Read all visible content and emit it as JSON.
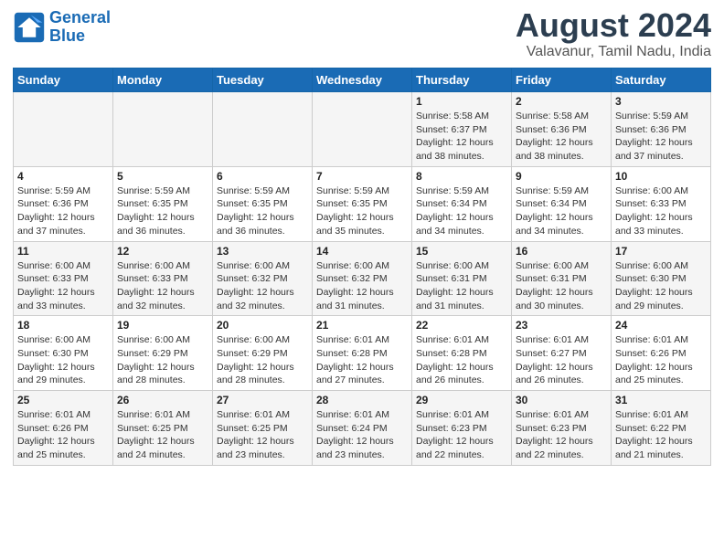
{
  "header": {
    "logo_line1": "General",
    "logo_line2": "Blue",
    "month_year": "August 2024",
    "location": "Valavanur, Tamil Nadu, India"
  },
  "weekdays": [
    "Sunday",
    "Monday",
    "Tuesday",
    "Wednesday",
    "Thursday",
    "Friday",
    "Saturday"
  ],
  "weeks": [
    [
      {
        "day": "",
        "info": ""
      },
      {
        "day": "",
        "info": ""
      },
      {
        "day": "",
        "info": ""
      },
      {
        "day": "",
        "info": ""
      },
      {
        "day": "1",
        "info": "Sunrise: 5:58 AM\nSunset: 6:37 PM\nDaylight: 12 hours\nand 38 minutes."
      },
      {
        "day": "2",
        "info": "Sunrise: 5:58 AM\nSunset: 6:36 PM\nDaylight: 12 hours\nand 38 minutes."
      },
      {
        "day": "3",
        "info": "Sunrise: 5:59 AM\nSunset: 6:36 PM\nDaylight: 12 hours\nand 37 minutes."
      }
    ],
    [
      {
        "day": "4",
        "info": "Sunrise: 5:59 AM\nSunset: 6:36 PM\nDaylight: 12 hours\nand 37 minutes."
      },
      {
        "day": "5",
        "info": "Sunrise: 5:59 AM\nSunset: 6:35 PM\nDaylight: 12 hours\nand 36 minutes."
      },
      {
        "day": "6",
        "info": "Sunrise: 5:59 AM\nSunset: 6:35 PM\nDaylight: 12 hours\nand 36 minutes."
      },
      {
        "day": "7",
        "info": "Sunrise: 5:59 AM\nSunset: 6:35 PM\nDaylight: 12 hours\nand 35 minutes."
      },
      {
        "day": "8",
        "info": "Sunrise: 5:59 AM\nSunset: 6:34 PM\nDaylight: 12 hours\nand 34 minutes."
      },
      {
        "day": "9",
        "info": "Sunrise: 5:59 AM\nSunset: 6:34 PM\nDaylight: 12 hours\nand 34 minutes."
      },
      {
        "day": "10",
        "info": "Sunrise: 6:00 AM\nSunset: 6:33 PM\nDaylight: 12 hours\nand 33 minutes."
      }
    ],
    [
      {
        "day": "11",
        "info": "Sunrise: 6:00 AM\nSunset: 6:33 PM\nDaylight: 12 hours\nand 33 minutes."
      },
      {
        "day": "12",
        "info": "Sunrise: 6:00 AM\nSunset: 6:33 PM\nDaylight: 12 hours\nand 32 minutes."
      },
      {
        "day": "13",
        "info": "Sunrise: 6:00 AM\nSunset: 6:32 PM\nDaylight: 12 hours\nand 32 minutes."
      },
      {
        "day": "14",
        "info": "Sunrise: 6:00 AM\nSunset: 6:32 PM\nDaylight: 12 hours\nand 31 minutes."
      },
      {
        "day": "15",
        "info": "Sunrise: 6:00 AM\nSunset: 6:31 PM\nDaylight: 12 hours\nand 31 minutes."
      },
      {
        "day": "16",
        "info": "Sunrise: 6:00 AM\nSunset: 6:31 PM\nDaylight: 12 hours\nand 30 minutes."
      },
      {
        "day": "17",
        "info": "Sunrise: 6:00 AM\nSunset: 6:30 PM\nDaylight: 12 hours\nand 29 minutes."
      }
    ],
    [
      {
        "day": "18",
        "info": "Sunrise: 6:00 AM\nSunset: 6:30 PM\nDaylight: 12 hours\nand 29 minutes."
      },
      {
        "day": "19",
        "info": "Sunrise: 6:00 AM\nSunset: 6:29 PM\nDaylight: 12 hours\nand 28 minutes."
      },
      {
        "day": "20",
        "info": "Sunrise: 6:00 AM\nSunset: 6:29 PM\nDaylight: 12 hours\nand 28 minutes."
      },
      {
        "day": "21",
        "info": "Sunrise: 6:01 AM\nSunset: 6:28 PM\nDaylight: 12 hours\nand 27 minutes."
      },
      {
        "day": "22",
        "info": "Sunrise: 6:01 AM\nSunset: 6:28 PM\nDaylight: 12 hours\nand 26 minutes."
      },
      {
        "day": "23",
        "info": "Sunrise: 6:01 AM\nSunset: 6:27 PM\nDaylight: 12 hours\nand 26 minutes."
      },
      {
        "day": "24",
        "info": "Sunrise: 6:01 AM\nSunset: 6:26 PM\nDaylight: 12 hours\nand 25 minutes."
      }
    ],
    [
      {
        "day": "25",
        "info": "Sunrise: 6:01 AM\nSunset: 6:26 PM\nDaylight: 12 hours\nand 25 minutes."
      },
      {
        "day": "26",
        "info": "Sunrise: 6:01 AM\nSunset: 6:25 PM\nDaylight: 12 hours\nand 24 minutes."
      },
      {
        "day": "27",
        "info": "Sunrise: 6:01 AM\nSunset: 6:25 PM\nDaylight: 12 hours\nand 23 minutes."
      },
      {
        "day": "28",
        "info": "Sunrise: 6:01 AM\nSunset: 6:24 PM\nDaylight: 12 hours\nand 23 minutes."
      },
      {
        "day": "29",
        "info": "Sunrise: 6:01 AM\nSunset: 6:23 PM\nDaylight: 12 hours\nand 22 minutes."
      },
      {
        "day": "30",
        "info": "Sunrise: 6:01 AM\nSunset: 6:23 PM\nDaylight: 12 hours\nand 22 minutes."
      },
      {
        "day": "31",
        "info": "Sunrise: 6:01 AM\nSunset: 6:22 PM\nDaylight: 12 hours\nand 21 minutes."
      }
    ]
  ]
}
